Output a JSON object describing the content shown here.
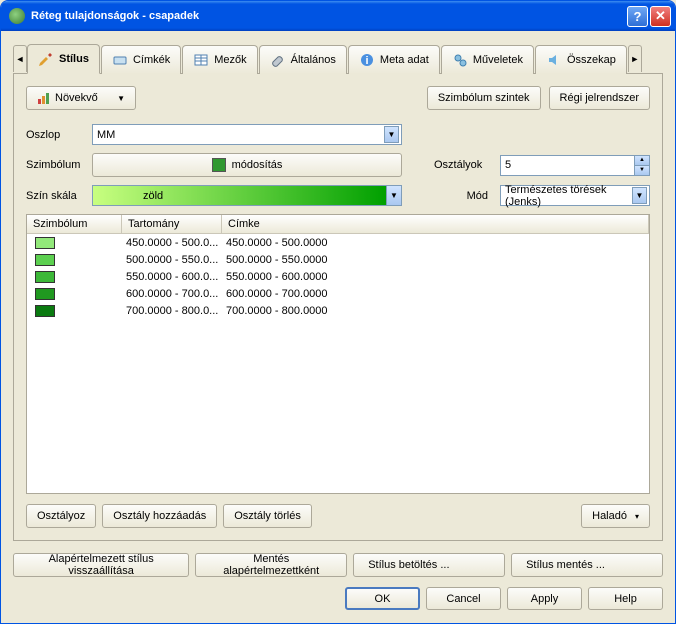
{
  "window": {
    "title": "Réteg tulajdonságok - csapadek"
  },
  "tabs": {
    "style": "Stílus",
    "labels": "Címkék",
    "fields": "Mezők",
    "general": "Általános",
    "metadata": "Meta adat",
    "actions": "Műveletek",
    "joins": "Összekap"
  },
  "renderer": {
    "type": "Növekvő"
  },
  "sideButtons": {
    "symbolLevels": "Szimbólum szintek",
    "oldSymbology": "Régi jelrendszer"
  },
  "column": {
    "label": "Oszlop",
    "value": "MM"
  },
  "symbol": {
    "label": "Szimbólum",
    "change": "módosítás"
  },
  "classes": {
    "label": "Osztályok",
    "value": "5"
  },
  "mode": {
    "label": "Mód",
    "value": "Természetes törések (Jenks)"
  },
  "ramp": {
    "label": "Szín skála",
    "value": "zöld"
  },
  "tableHeaders": {
    "symbol": "Szimbólum",
    "range": "Tartomány",
    "label": "Címke"
  },
  "rows": [
    {
      "color": "#92e87a",
      "range": "450.0000 - 500.0...",
      "label": "450.0000 - 500.0000"
    },
    {
      "color": "#5cd050",
      "range": "500.0000 - 550.0...",
      "label": "500.0000 - 550.0000"
    },
    {
      "color": "#3cb838",
      "range": "550.0000 - 600.0...",
      "label": "550.0000 - 600.0000"
    },
    {
      "color": "#209820",
      "range": "600.0000 - 700.0...",
      "label": "600.0000 - 700.0000"
    },
    {
      "color": "#0a7a10",
      "range": "700.0000 - 800.0...",
      "label": "700.0000 - 800.0000"
    }
  ],
  "classButtons": {
    "classify": "Osztályoz",
    "add": "Osztály hozzáadás",
    "delete": "Osztály törlés",
    "advanced": "Haladó"
  },
  "styleButtons": {
    "restore": "Alapértelmezett stílus visszaállítása",
    "saveDefault": "Mentés alapértelmezettként",
    "load": "Stílus betöltés ...",
    "save": "Stílus mentés ..."
  },
  "dialogButtons": {
    "ok": "OK",
    "cancel": "Cancel",
    "apply": "Apply",
    "help": "Help"
  }
}
